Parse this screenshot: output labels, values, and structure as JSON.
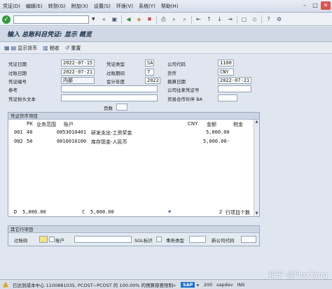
{
  "menu": {
    "items": [
      "凭证(D)",
      "编辑(E)",
      "转到(G)",
      "附加(X)",
      "设置(S)",
      "环境(V)",
      "系统(Y)",
      "帮助(H)"
    ]
  },
  "window": {
    "min": "–",
    "max": "□",
    "close": "✕"
  },
  "title": "输入 总账科目凭证: 显示 概览",
  "app_toolbar": {
    "display_currency": "显示货币",
    "tax": "税收",
    "reset": "重置"
  },
  "header": {
    "doc_date_label": "凭证日期",
    "doc_date": "2022-07-15",
    "doc_type_label": "凭证类型",
    "doc_type": "SA",
    "company_code_label": "公司代码",
    "company_code": "1100",
    "posting_date_label": "过账日期",
    "posting_date": "2022-07-21",
    "posting_period_label": "过账期间",
    "posting_period": "7",
    "currency_label": "货币",
    "currency": "CNY",
    "doc_number_label": "凭证编号",
    "doc_number": "内部",
    "fiscal_year_label": "会计年度",
    "fiscal_year": "2022",
    "translation_date_label": "换算日期",
    "translation_date": "2022-07-21",
    "reference_label": "参考",
    "cross_cc_label": "公司往来凭证号",
    "header_text_label": "凭证抬头文本",
    "trading_partner_label": "贸易合作伙伴 BA",
    "page_label": "页数"
  },
  "items_group": {
    "title": "凭证货币项目",
    "columns": [
      "PK",
      "业务范围",
      "账户",
      "CNY",
      "金额",
      "税金"
    ],
    "rows": [
      {
        "no": "001",
        "pk": "40",
        "account": "0053010401",
        "text": "研发支出-工资奖金",
        "amount": "5,000.00"
      },
      {
        "no": "002",
        "pk": "50",
        "account": "0010010100",
        "text": "库存现金-人民币",
        "amount": "5,000.00-"
      }
    ],
    "debit_label": "D",
    "debit": "5,000.00",
    "credit_label": "C",
    "credit": "5,000.00",
    "item_count": "2",
    "item_count_label": "行项目个数"
  },
  "other_group": {
    "title": "其它行项目",
    "posting_key_label": "过账码",
    "sgl_label": "SGL标识",
    "trans_type_label": "事务类型",
    "new_cc_label": "新公司代码"
  },
  "status": {
    "message": "已达到成本中心 1100881035, PCOST~PCOST 的 100.00% 的预算容差限制»",
    "sap": "SAP",
    "client": "200",
    "server": "sapdev",
    "mode": "INS"
  },
  "watermark": "知乎 @FlexYang"
}
